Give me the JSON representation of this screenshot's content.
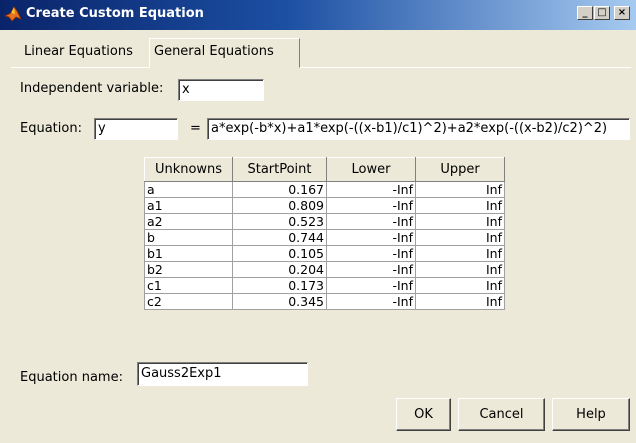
{
  "window": {
    "title": "Create Custom Equation",
    "min_label": "_",
    "max_label": "□",
    "close_label": "×"
  },
  "tabs": [
    {
      "label": "Linear Equations",
      "active": false
    },
    {
      "label": "General Equations",
      "active": true
    }
  ],
  "form": {
    "independent_label": "Independent variable:",
    "independent_value": "x",
    "equation_label": "Equation:",
    "equation_lhs": "y",
    "equals": "=",
    "equation_rhs": "a*exp(-b*x)+a1*exp(-((x-b1)/c1)^2)+a2*exp(-((x-b2)/c2)^2)",
    "name_label": "Equation name:",
    "name_value": "Gauss2Exp1"
  },
  "table": {
    "headers": [
      "Unknowns",
      "StartPoint",
      "Lower",
      "Upper"
    ],
    "rows": [
      [
        "a",
        "0.167",
        "-Inf",
        "Inf"
      ],
      [
        "a1",
        "0.809",
        "-Inf",
        "Inf"
      ],
      [
        "a2",
        "0.523",
        "-Inf",
        "Inf"
      ],
      [
        "b",
        "0.744",
        "-Inf",
        "Inf"
      ],
      [
        "b1",
        "0.105",
        "-Inf",
        "Inf"
      ],
      [
        "b2",
        "0.204",
        "-Inf",
        "Inf"
      ],
      [
        "c1",
        "0.173",
        "-Inf",
        "Inf"
      ],
      [
        "c2",
        "0.345",
        "-Inf",
        "Inf"
      ]
    ]
  },
  "buttons": {
    "ok": "OK",
    "cancel": "Cancel",
    "help": "Help"
  }
}
